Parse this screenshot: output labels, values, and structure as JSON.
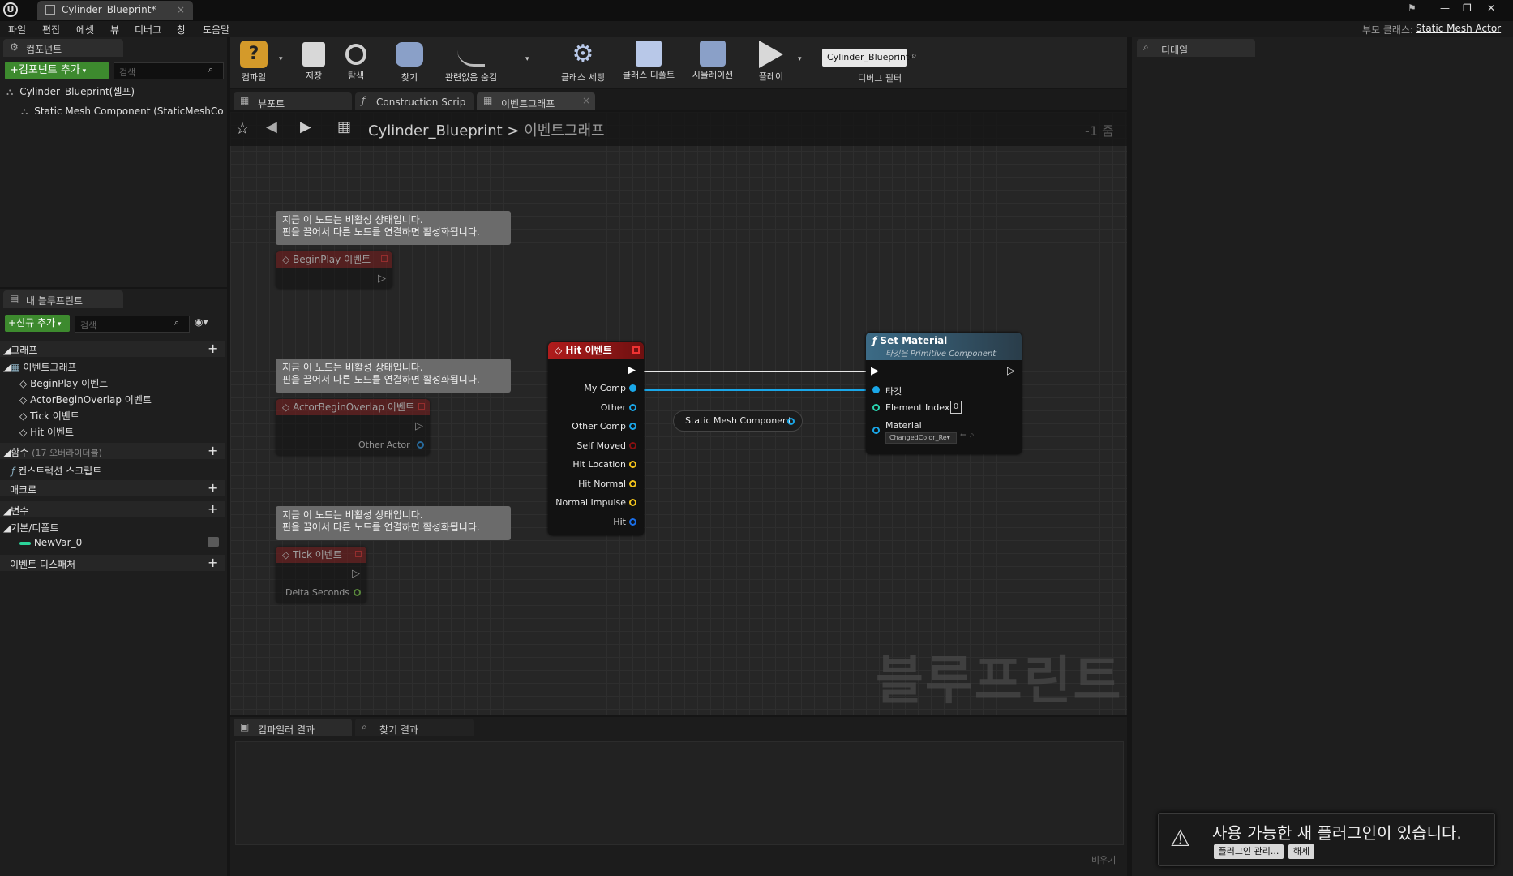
{
  "window": {
    "tab_title": "Cylinder_Blueprint*",
    "parent_class_label": "부모 클래스:",
    "parent_class_value": "Static Mesh Actor"
  },
  "menu": [
    "파일",
    "편집",
    "에셋",
    "뷰",
    "디버그",
    "창",
    "도움말"
  ],
  "components_panel": {
    "tab": "컴포넌트",
    "add_button": "+컴포넌트 추가",
    "search_placeholder": "검색",
    "root": "Cylinder_Blueprint(셀프)",
    "child": "Static Mesh Component (StaticMeshComp"
  },
  "my_blueprint": {
    "tab": "내 블루프린트",
    "add_button": "+신규 추가",
    "search_placeholder": "검색",
    "sections": {
      "graph": "그래프",
      "event_graph": "이벤트그래프",
      "events": [
        "BeginPlay 이벤트",
        "ActorBeginOverlap 이벤트",
        "Tick 이벤트",
        "Hit 이벤트"
      ],
      "functions": "함수",
      "functions_override": "(17 오버라이더블)",
      "construction": "컨스트럭션 스크립트",
      "macros": "매크로",
      "variables": "변수",
      "default_category": "기본/디폴트",
      "variable": "NewVar_0",
      "dispatchers": "이벤트 디스패처"
    }
  },
  "toolbar": {
    "compile": "컴파일",
    "save": "저장",
    "browse": "탐색",
    "find": "찾기",
    "hide_unrelated": "관련없음 숨김",
    "class_settings": "클래스 세팅",
    "class_defaults": "클래스 디폴트",
    "simulation": "시뮬레이션",
    "play": "플레이",
    "debug_object": "Cylinder_Blueprint",
    "debug_filter": "디버그 필터"
  },
  "editor_tabs": [
    "뷰포트",
    "Construction Scrip",
    "이벤트그래프"
  ],
  "breadcrumb": {
    "blueprint": "Cylinder_Blueprint",
    "graph": "이벤트그래프",
    "zoom": "-1 줌"
  },
  "graph": {
    "comment_line1": "지금 이 노드는 비활성 상태입니다.",
    "comment_line2": "핀을 끌어서 다른 노드를 연결하면 활성화됩니다.",
    "begin_play": "BeginPlay 이벤트",
    "actor_overlap": "ActorBeginOverlap 이벤트",
    "other_actor": "Other Actor",
    "tick": "Tick 이벤트",
    "delta_seconds": "Delta Seconds",
    "hit_event": "Hit 이벤트",
    "hit_pins": [
      "My Comp",
      "Other",
      "Other Comp",
      "Self Moved",
      "Hit Location",
      "Hit Normal",
      "Normal Impulse",
      "Hit"
    ],
    "static_mesh": "Static Mesh Component",
    "set_material": "Set Material",
    "set_material_sub": "타깃은 Primitive Component",
    "target": "타깃",
    "element_index": "Element Index",
    "element_index_value": "0",
    "material": "Material",
    "material_value": "ChangedColor_Re",
    "watermark": "블루프린트"
  },
  "details_panel": {
    "tab": "디테일"
  },
  "bottom": {
    "compiler_results": "컴파일러 결과",
    "find_results": "찾기 결과",
    "clear": "비우기"
  },
  "notification": {
    "text": "사용 가능한 새 플러그인이 있습니다.",
    "manage": "플러그인 관리...",
    "dismiss": "해제"
  }
}
